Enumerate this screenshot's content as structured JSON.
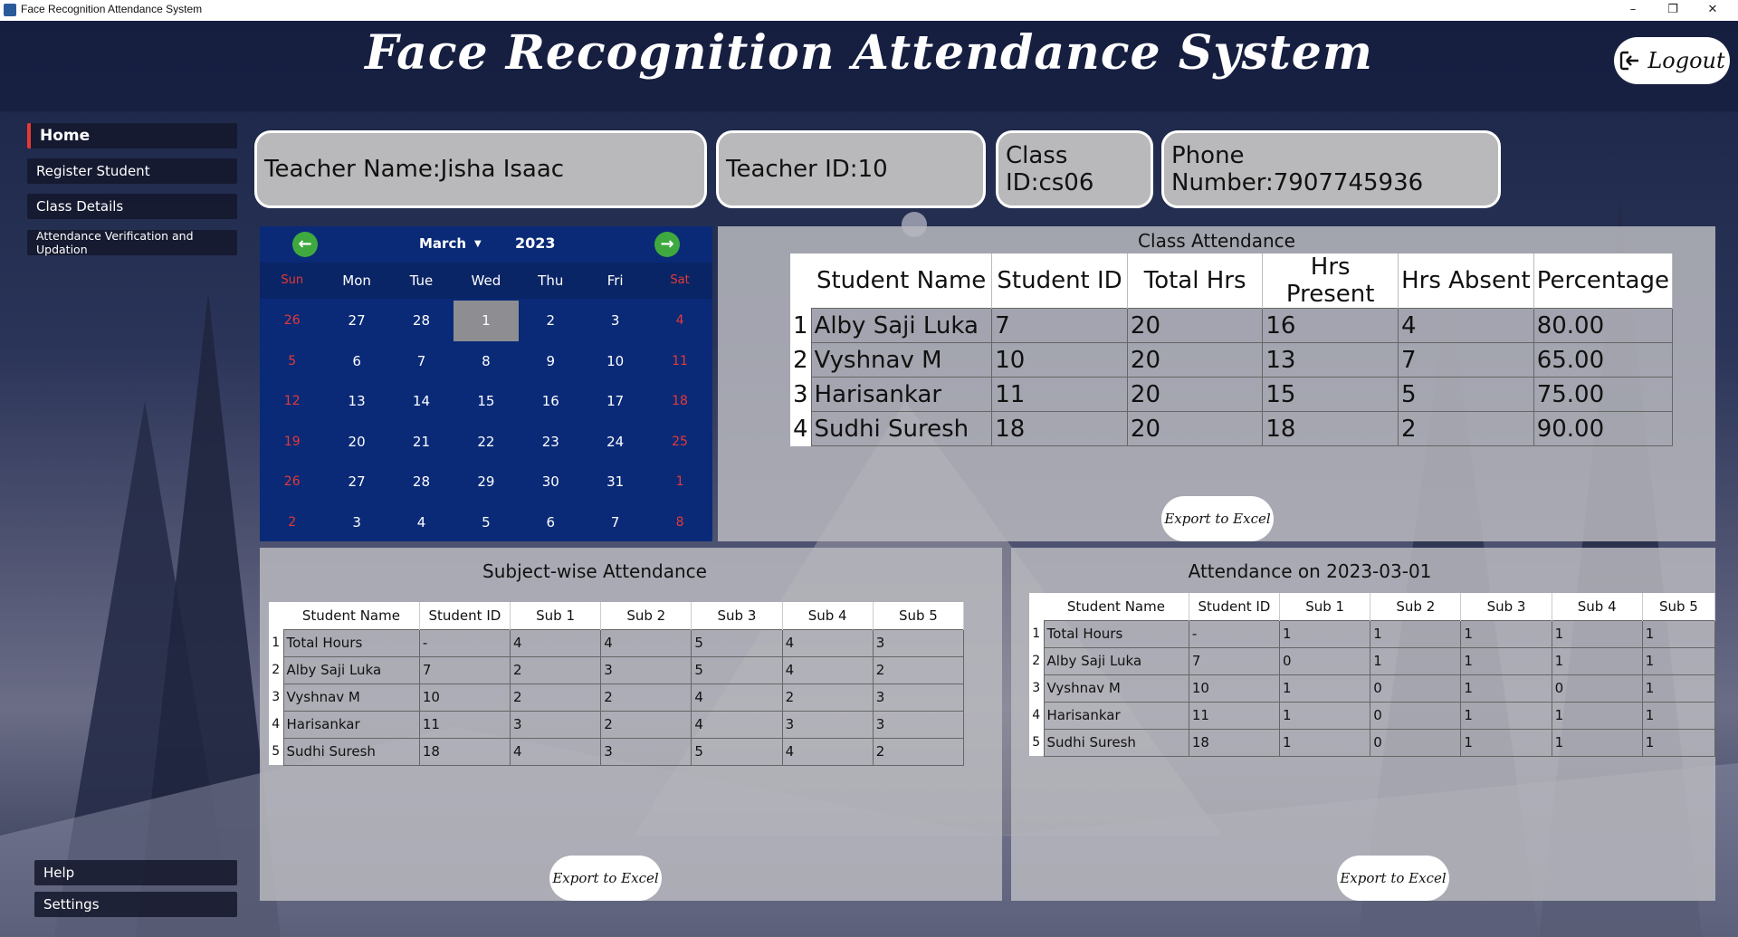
{
  "window": {
    "title": "Face Recognition Attendance System",
    "minimize": "–",
    "restore": "❐",
    "close": "✕"
  },
  "header": {
    "title": "Face Recognition Attendance System",
    "logout_label": "Logout"
  },
  "sidebar": {
    "items": [
      {
        "label": "Home"
      },
      {
        "label": "Register Student"
      },
      {
        "label": "Class Details"
      },
      {
        "label": "Attendance Verification and Updation"
      }
    ],
    "bottom_items": [
      {
        "label": "Help"
      },
      {
        "label": "Settings"
      }
    ]
  },
  "teacher": {
    "name": "Teacher Name:Jisha Isaac",
    "id": "Teacher ID:10",
    "class_id": "Class ID:cs06",
    "phone": "Phone Number:7907745936"
  },
  "calendar": {
    "month": "March",
    "year": "2023",
    "days_of_week": [
      "Sun",
      "Mon",
      "Tue",
      "Wed",
      "Thu",
      "Fri",
      "Sat"
    ],
    "weeks": [
      [
        "26",
        "27",
        "28",
        "1",
        "2",
        "3",
        "4"
      ],
      [
        "5",
        "6",
        "7",
        "8",
        "9",
        "10",
        "11"
      ],
      [
        "12",
        "13",
        "14",
        "15",
        "16",
        "17",
        "18"
      ],
      [
        "19",
        "20",
        "21",
        "22",
        "23",
        "24",
        "25"
      ],
      [
        "26",
        "27",
        "28",
        "29",
        "30",
        "31",
        "1"
      ],
      [
        "2",
        "3",
        "4",
        "5",
        "6",
        "7",
        "8"
      ]
    ],
    "selected": "1"
  },
  "class_attendance": {
    "title": "Class Attendance",
    "columns": [
      "Student Name",
      "Student ID",
      "Total Hrs",
      "Hrs Present",
      "Hrs Absent",
      "Percentage"
    ],
    "rows": [
      [
        "1",
        "Alby Saji Luka",
        "7",
        "20",
        "16",
        "4",
        "80.00"
      ],
      [
        "2",
        "Vyshnav M",
        "10",
        "20",
        "13",
        "7",
        "65.00"
      ],
      [
        "3",
        "Harisankar",
        "11",
        "20",
        "15",
        "5",
        "75.00"
      ],
      [
        "4",
        "Sudhi Suresh",
        "18",
        "20",
        "18",
        "2",
        "90.00"
      ]
    ],
    "export_label": "Export to Excel"
  },
  "subject_attendance": {
    "title": "Subject-wise Attendance",
    "columns": [
      "Student Name",
      "Student ID",
      "Sub 1",
      "Sub 2",
      "Sub 3",
      "Sub 4",
      "Sub 5"
    ],
    "rows": [
      [
        "1",
        "Total Hours",
        "-",
        "4",
        "4",
        "5",
        "4",
        "3"
      ],
      [
        "2",
        "Alby Saji Luka",
        "7",
        "2",
        "3",
        "5",
        "4",
        "2"
      ],
      [
        "3",
        "Vyshnav M",
        "10",
        "2",
        "2",
        "4",
        "2",
        "3"
      ],
      [
        "4",
        "Harisankar",
        "11",
        "3",
        "2",
        "4",
        "3",
        "3"
      ],
      [
        "5",
        "Sudhi Suresh",
        "18",
        "4",
        "3",
        "5",
        "4",
        "2"
      ]
    ],
    "export_label": "Export to Excel"
  },
  "date_attendance": {
    "title": "Attendance on 2023-03-01",
    "columns": [
      "Student Name",
      "Student ID",
      "Sub 1",
      "Sub 2",
      "Sub 3",
      "Sub 4",
      "Sub 5"
    ],
    "rows": [
      [
        "1",
        "Total Hours",
        "-",
        "1",
        "1",
        "1",
        "1",
        "1"
      ],
      [
        "2",
        "Alby Saji Luka",
        "7",
        "0",
        "1",
        "1",
        "1",
        "1"
      ],
      [
        "3",
        "Vyshnav M",
        "10",
        "1",
        "0",
        "1",
        "0",
        "1"
      ],
      [
        "4",
        "Harisankar",
        "11",
        "1",
        "0",
        "1",
        "1",
        "1"
      ],
      [
        "5",
        "Sudhi Suresh",
        "18",
        "1",
        "0",
        "1",
        "1",
        "1"
      ]
    ],
    "export_label": "Export to Excel"
  },
  "colors": {
    "calendar_bg": "#0a2a78",
    "weekend": "#e53935",
    "nav_arrow": "#3fa93f",
    "accent_home": "#e53935"
  }
}
